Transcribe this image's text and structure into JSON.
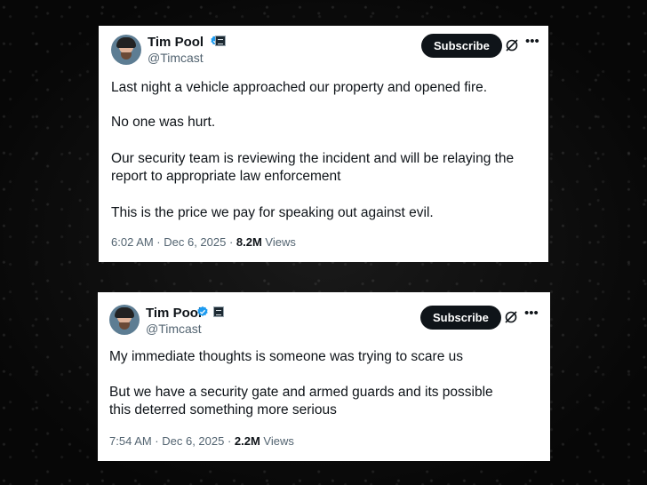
{
  "tweets": [
    {
      "author": {
        "name": "Tim Pool",
        "handle": "@Timcast",
        "verified_color": "#1d9bf0"
      },
      "subscribe_label": "Subscribe",
      "icons": [
        "grok-icon",
        "more-icon"
      ],
      "paragraphs": [
        "Last night a vehicle approached our property and opened fire.",
        "No one was hurt.",
        "Our security team is reviewing the incident and will be relaying the report to appropriate law enforcement",
        "This is the price we pay for speaking out against evil."
      ],
      "timestamp": "6:02 AM · Dec 6, 2025 · ",
      "views_count": "8.2M",
      "views_label": " Views"
    },
    {
      "author": {
        "name": "Tim Pool",
        "handle": "@Timcast",
        "verified_color": "#1d9bf0"
      },
      "subscribe_label": "Subscribe",
      "icons": [
        "grok-icon",
        "more-icon"
      ],
      "paragraphs": [
        "My immediate thoughts is someone was trying to scare us",
        "But we have a security gate and armed guards and its possible this deterred something more serious"
      ],
      "timestamp": "7:54 AM · Dec 6, 2025 · ",
      "views_count": "2.2M",
      "views_label": " Views"
    }
  ]
}
